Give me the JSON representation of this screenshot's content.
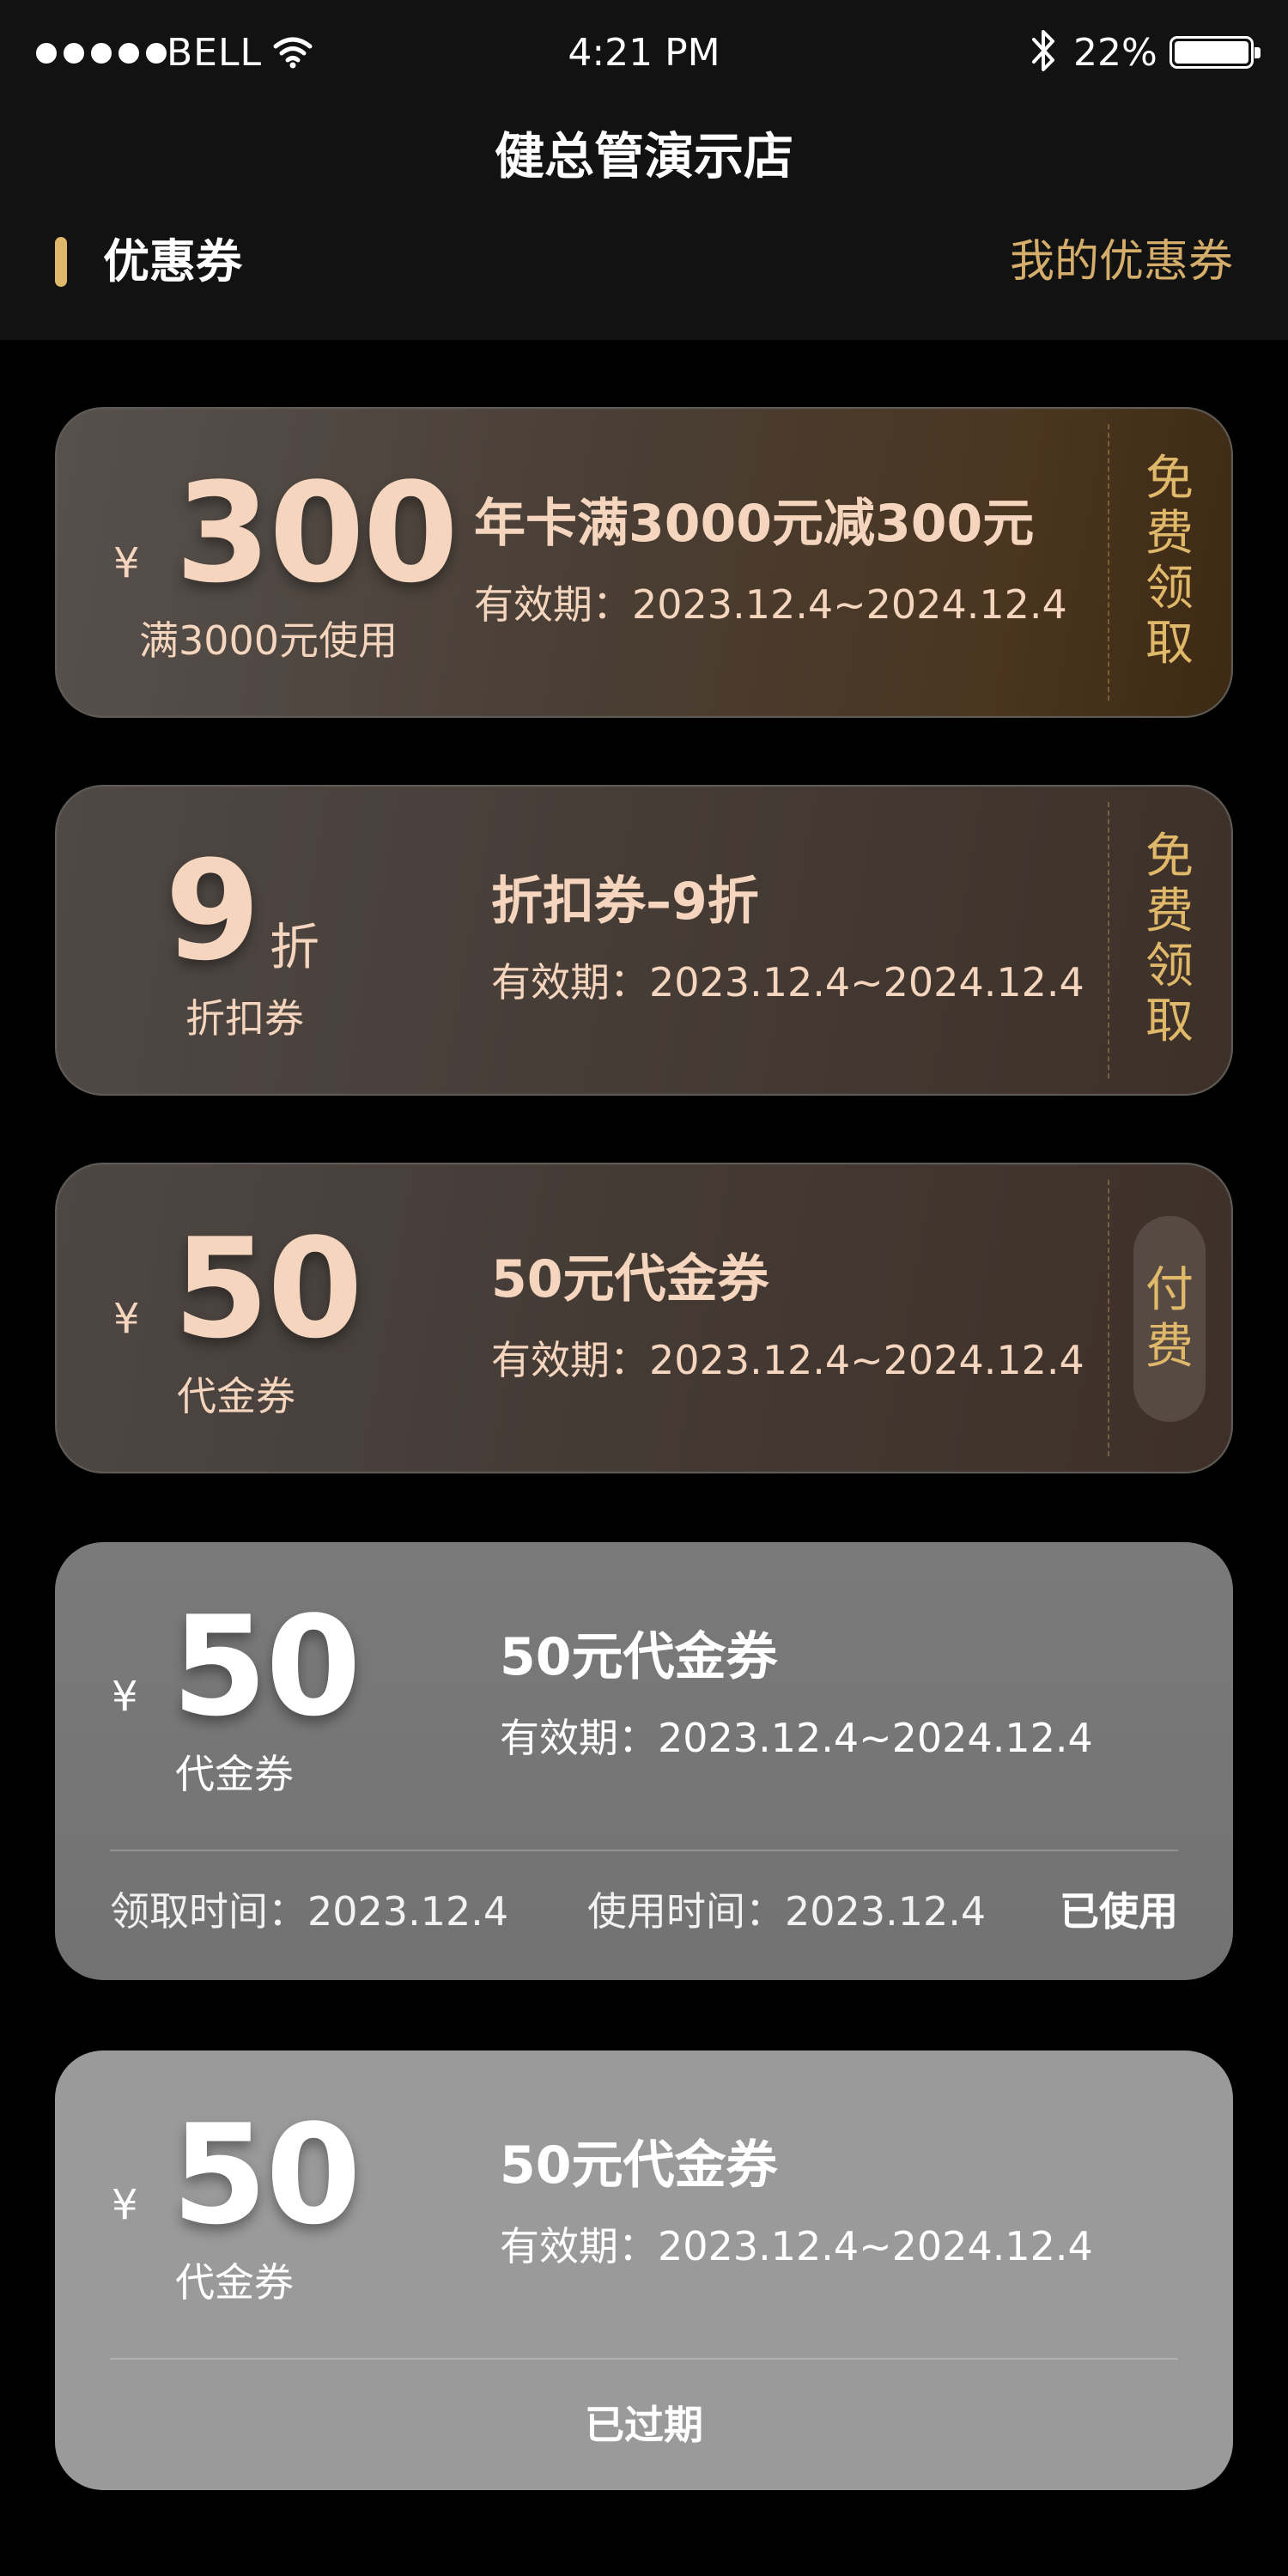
{
  "status_bar": {
    "carrier": "BELL",
    "time": "4:21 PM",
    "battery": "22%"
  },
  "header": {
    "title": "健总管演示店",
    "section_title": "优惠券",
    "my_coupons_link": "我的优惠券"
  },
  "coupons": [
    {
      "currency": "¥",
      "amount": "300",
      "condition": "满3000元使用",
      "name": "年卡满3000元减300元",
      "validity": "有效期：2023.12.4~2024.12.4",
      "action": "免费领取"
    },
    {
      "amount": "9",
      "unit": "折",
      "condition": "折扣券",
      "name": "折扣券–9折",
      "validity": "有效期：2023.12.4~2024.12.4",
      "action": "免费领取"
    },
    {
      "currency": "¥",
      "amount": "50",
      "condition": "代金券",
      "name": "50元代金券",
      "validity": "有效期：2023.12.4~2024.12.4",
      "action": "付费"
    },
    {
      "currency": "¥",
      "amount": "50",
      "condition": "代金券",
      "name": "50元代金券",
      "validity": "有效期：2023.12.4~2024.12.4",
      "received_time": "领取时间：2023.12.4",
      "used_time": "使用时间：2023.12.4",
      "status": "已使用"
    },
    {
      "currency": "¥",
      "amount": "50",
      "condition": "代金券",
      "name": "50元代金券",
      "validity": "有效期：2023.12.4~2024.12.4",
      "status": "已过期"
    }
  ],
  "colors": {
    "accent_gold": "#e0b869",
    "amount_peach": "#f5d5bd",
    "header_bg": "#121212",
    "page_bg": "#000000",
    "used_card": "#777777",
    "expired_card": "#9a9a9a"
  },
  "icons": [
    "signal-dots-icon",
    "wifi-icon",
    "bluetooth-icon",
    "battery-icon"
  ]
}
